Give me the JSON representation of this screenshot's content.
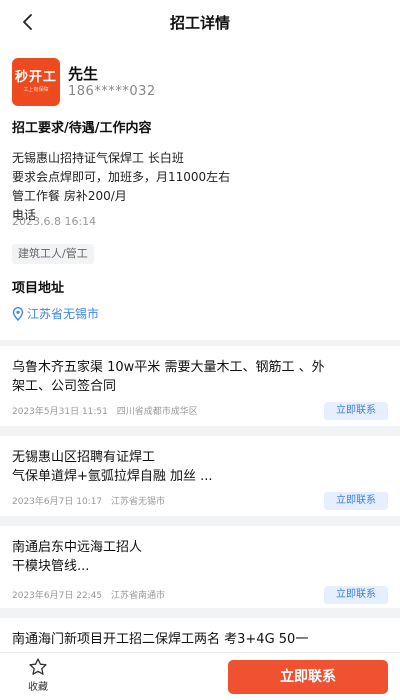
{
  "header": {
    "title": "招工详情",
    "back_icon": "chevron-left-icon"
  },
  "poster": {
    "logo_text": "秒开工",
    "logo_subtext": "工上有保障",
    "logo_color": "#ee4a1f",
    "name": "先生",
    "phone": "186*****032"
  },
  "detail": {
    "section_title": "招工要求/待遇/工作内容",
    "lines": [
      "无锡惠山招持证气保焊工 长白班",
      "要求会点焊即可，加班多，月11000左右",
      "管工作餐 房补200/月",
      "电话"
    ],
    "post_time": "2023.6.8 16:14",
    "tag": "建筑工人/管工",
    "location_title": "项目地址",
    "location": "江苏省无锡市",
    "location_icon": "map-pin-icon"
  },
  "jobs": [
    {
      "title_lines": [
        "乌鲁木齐五家渠 10w平米 需要大量木工、钢筋工 、外",
        "架工、公司签合同"
      ],
      "date": "2023年5月31日 11:51",
      "place": "四川省成都市成华区",
      "action": "立即联系"
    },
    {
      "title_lines": [
        "无锡惠山区招聘有证焊工",
        "气保单道焊+氩弧拉焊自融 加丝 ..."
      ],
      "date": "2023年6月7日 10:17",
      "place": "江苏省无锡市",
      "action": "立即联系"
    },
    {
      "title_lines": [
        "南通启东中远海工招人",
        "干模块管线..."
      ],
      "date": "2023年6月7日 22:45",
      "place": "江苏省南通市",
      "action": "立即联系"
    },
    {
      "title_lines": [
        "南通海门新项目开工招二保焊工两名  考3+4G  50一"
      ],
      "date": "",
      "place": "",
      "action": ""
    }
  ],
  "bottom": {
    "favorite_label": "收藏",
    "favorite_icon": "star-icon",
    "contact_label": "立即联系",
    "accent": "#f05231",
    "link_color": "#3b86f5"
  }
}
